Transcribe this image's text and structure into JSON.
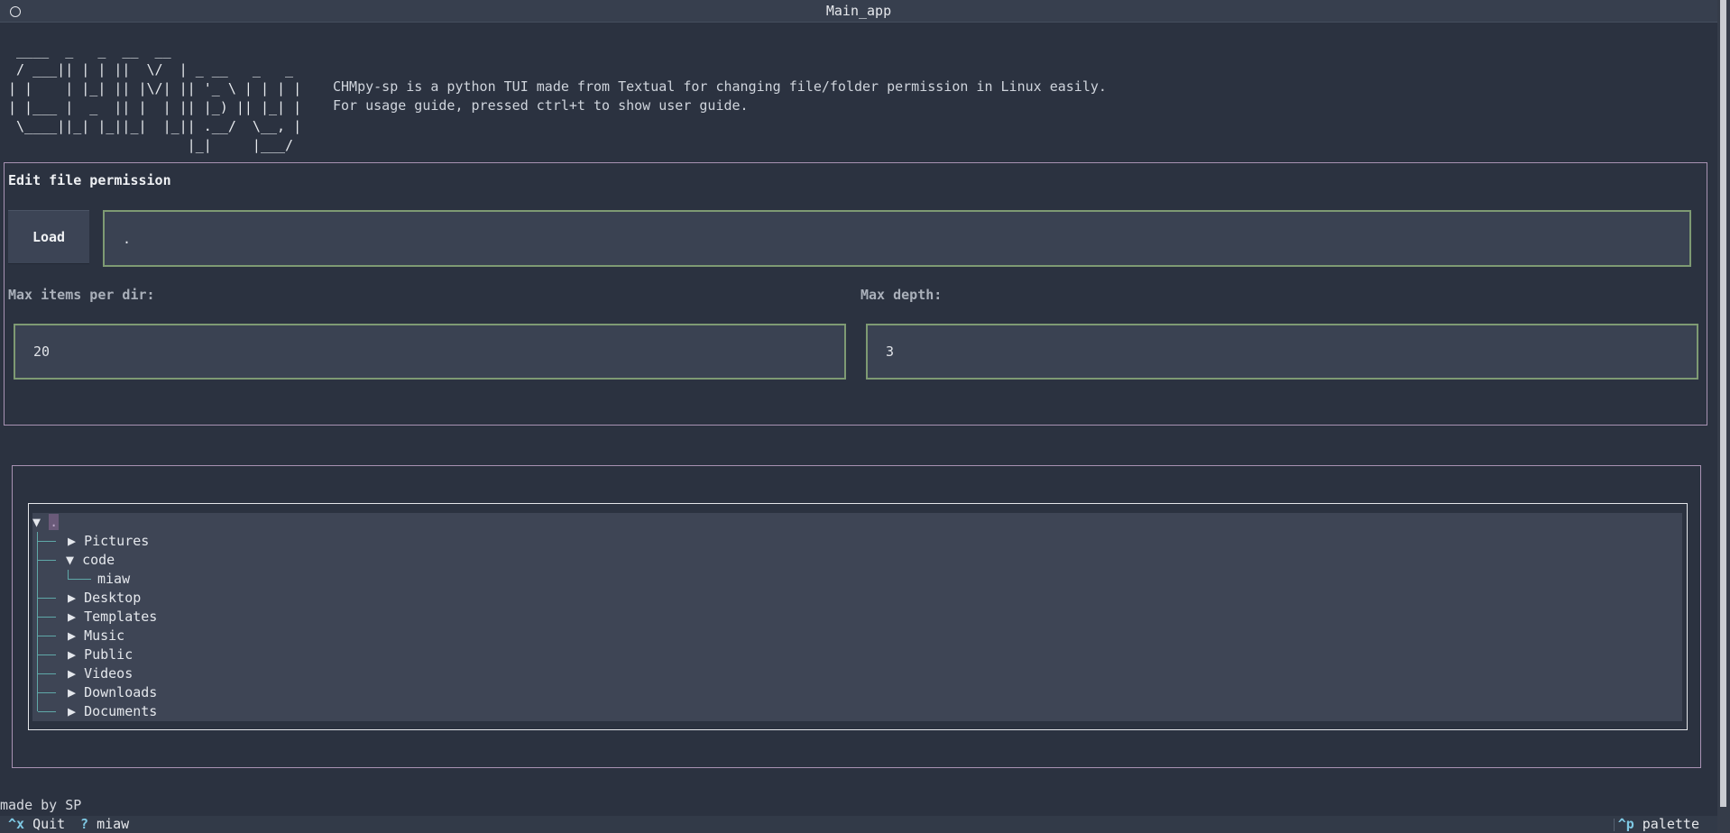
{
  "window": {
    "title": "Main_app"
  },
  "banner": {
    "ascii_art": " ____  _   _  __  __\n / ___|| | | ||  \\/  | _ __   _   _\n| |    | |_| || |\\/| || '_ \\ | | | |\n| |___ |  _  || |  | || |_) || |_| |\n \\____||_| |_||_|  |_|| .__/  \\__, |\n                      |_|     |___/",
    "description_line1": "CHMpy-sp is a python TUI made from Textual for changing file/folder permission in Linux easily.",
    "description_line2": "For usage guide, pressed ctrl+t to show user guide."
  },
  "edit_panel": {
    "title": "Edit file permission",
    "load_label": "Load",
    "path_value": ".",
    "max_items_label": "Max items per dir:",
    "max_items_value": "20",
    "max_depth_label": "Max depth:",
    "max_depth_value": "3"
  },
  "tree": {
    "root_label": ".",
    "nodes": [
      {
        "label": "Pictures",
        "arrow": "▶"
      },
      {
        "label": "code",
        "arrow": "▼",
        "children": [
          {
            "label": "miaw"
          }
        ]
      },
      {
        "label": "Desktop",
        "arrow": "▶"
      },
      {
        "label": "Templates",
        "arrow": "▶"
      },
      {
        "label": "Music",
        "arrow": "▶"
      },
      {
        "label": "Public",
        "arrow": "▶"
      },
      {
        "label": "Videos",
        "arrow": "▶"
      },
      {
        "label": "Downloads",
        "arrow": "▶"
      },
      {
        "label": "Documents",
        "arrow": "▶"
      }
    ],
    "root_arrow": "▼"
  },
  "made_by": "made by SP",
  "footer": {
    "quit_key": "^x",
    "quit_label": "Quit",
    "help_key": "?",
    "help_label": "miaw",
    "palette_key": "^p",
    "palette_label": "palette"
  },
  "colors": {
    "background": "#2b3240",
    "panel_border": "#a892b3",
    "input_border": "#7e9a73",
    "tree_guide": "#5fa8a8",
    "footer_key": "#7ec8e3"
  }
}
